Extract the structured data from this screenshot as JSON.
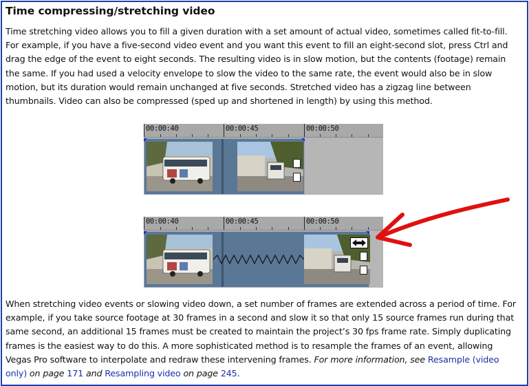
{
  "doc": {
    "title": "Time compressing/stretching video",
    "para1": "Time stretching video allows you to fill a given duration with a set amount of actual video, sometimes called fit-to-fill. For example, if you have a five-second video event and you want this event to fill an eight-second slot, press Ctrl and drag the edge of the event to eight seconds. The resulting video is in slow motion, but the contents (footage) remain the same. If you had used a velocity envelope to slow the video to the same rate, the event would also be in slow motion, but its duration would remain unchanged at five seconds. Stretched video has a zigzag line between thumbnails. Video can also be compressed (sped up and shortened in length) by using this method.",
    "para2_text": "When stretching video events or slowing video down, a set number of frames are extended across a period of time. For example, if you take source footage at 30 frames in a second and slow it so that only 15 source frames run during that same second, an additional 15 frames must be created to maintain the project’s 30 fps frame rate. Simply duplicating frames is the easiest way to do this. A more sophisticated method is to resample the frames of an event, allowing Vegas Pro software to interpolate and redraw these intervening frames. ",
    "para2_italic_a": "For more information, see ",
    "link1": "Resample (video only)",
    "para2_italic_b": " on page ",
    "page1": "171",
    "para2_italic_c": " and ",
    "link2": "Resampling video",
    "para2_italic_d": " on page ",
    "page2": "245",
    "para2_end": "."
  },
  "timelines": [
    {
      "ticks": [
        "00:00:40",
        "00:00:45",
        "00:00:50"
      ]
    },
    {
      "ticks": [
        "00:00:40",
        "00:00:45",
        "00:00:50"
      ]
    }
  ],
  "colors": {
    "link": "#1a2fa8",
    "border": "#1f3fa8",
    "annotation_arrow": "#e01010",
    "event": "#5b7796"
  },
  "icons": {
    "stretch_cursor": "stretch-cursor-icon",
    "zigzag": "zigzag-line"
  }
}
